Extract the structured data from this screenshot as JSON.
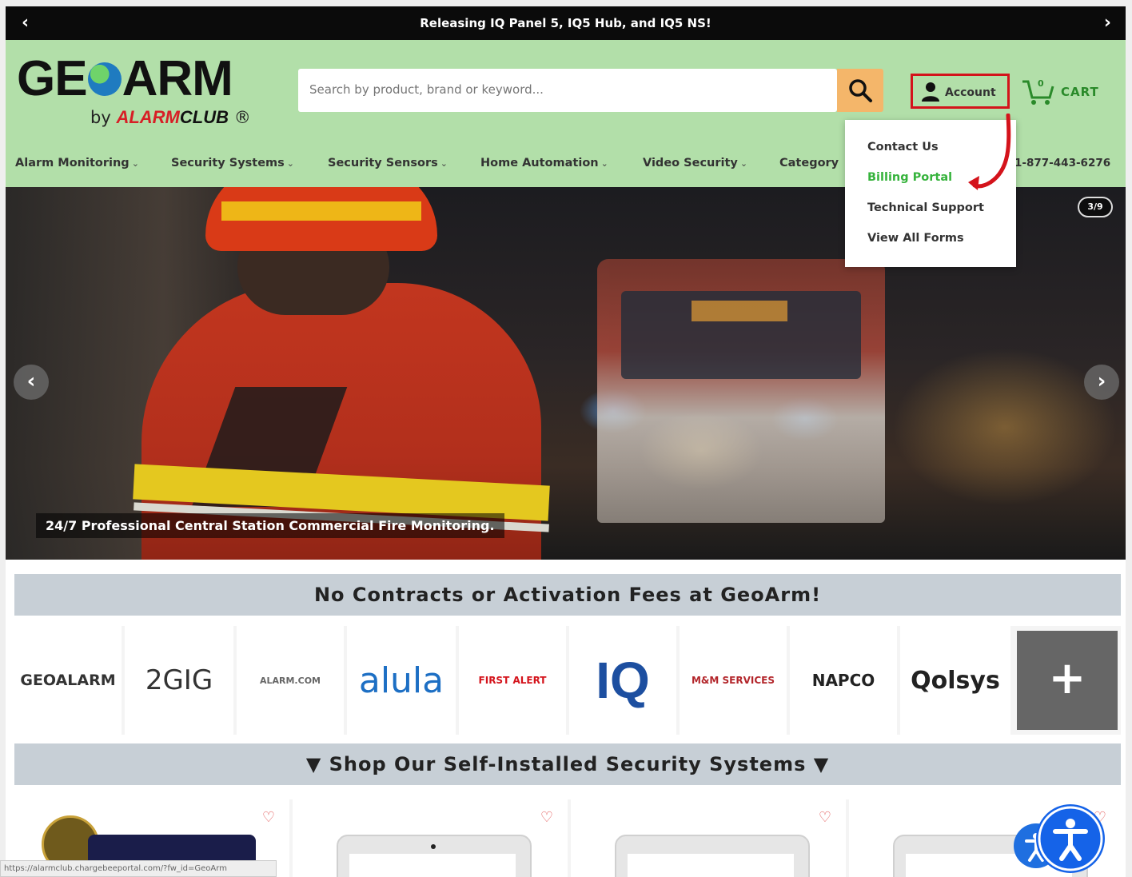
{
  "announcement": {
    "message": "Releasing IQ Panel 5, IQ5 Hub, and IQ5 NS!",
    "prev_icon": "chevron-left-icon",
    "next_icon": "chevron-right-icon"
  },
  "logo": {
    "brand_left": "GE",
    "brand_right": "ARM",
    "sub_by": "by",
    "sub_alarm": "ALARM",
    "sub_club": "CLUB",
    "sub_reg": "®"
  },
  "search": {
    "placeholder": "Search by product, brand or keyword...",
    "value": "",
    "button_icon": "search-icon"
  },
  "header": {
    "account_label": "Account",
    "cart_label": "CART",
    "cart_count": "0",
    "phone": "1-877-443-6276"
  },
  "nav": {
    "items": [
      "Alarm Monitoring",
      "Security Systems",
      "Security Sensors",
      "Home Automation",
      "Video Security",
      "Category"
    ],
    "chevron": "⌄"
  },
  "account_menu": {
    "items": [
      "Contact Us",
      "Billing Portal",
      "Technical Support",
      "View All Forms"
    ],
    "active_index": 1
  },
  "hero": {
    "caption": "24/7 Professional Central Station Commercial Fire Monitoring.",
    "slide_counter": "3/9"
  },
  "banners": {
    "no_contracts": "No Contracts or Activation Fees at GeoArm!",
    "shop_systems": "▼ Shop Our Self-Installed Security Systems ▼"
  },
  "brands": [
    "GEOALARM",
    "2GIG",
    "ALARM.COM",
    "alula",
    "FIRST ALERT",
    "IQ",
    "M&M SERVICES",
    "NAPCO",
    "Qolsys"
  ],
  "brands_more": "+",
  "status_url": "https://alarmclub.chargebeeportal.com/?fw_id=GeoArm",
  "colors": {
    "header_bg": "#b2dfa9",
    "search_button": "#f4b66a",
    "highlight_border": "#d4131b",
    "active_menu": "#36b33c",
    "a11y_blue": "#1563e8"
  }
}
